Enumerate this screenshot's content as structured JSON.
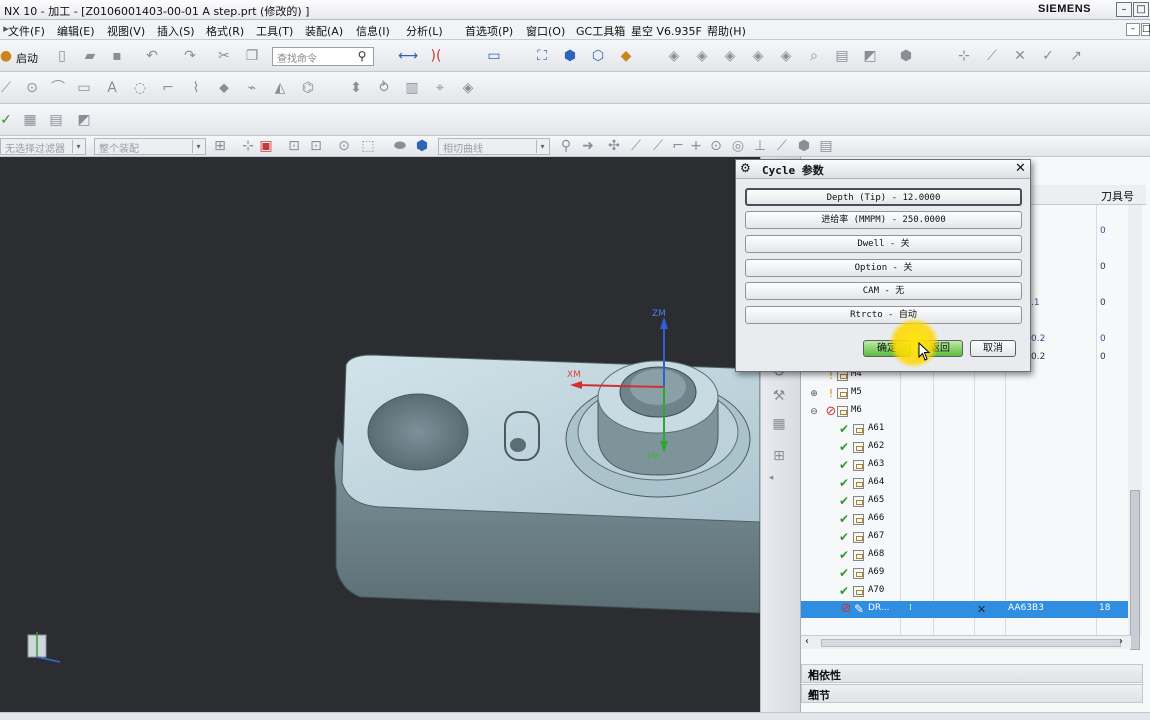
{
  "window": {
    "title": "NX 10 - 加工 - [Z0106001403-00-01 A step.prt  (修改的) ]",
    "brand": "SIEMENS"
  },
  "menu": [
    "文件(F)",
    "编辑(E)",
    "视图(V)",
    "插入(S)",
    "格式(R)",
    "工具(T)",
    "装配(A)",
    "信息(I)",
    "分析(L)",
    "首选项(P)",
    "窗口(O)",
    "GC工具箱",
    "星空 V6.935F",
    "帮助(H)"
  ],
  "toolbar": {
    "start_label": "启动",
    "search_placeholder": "查找命令",
    "filter_combo": "无选择过滤器",
    "assembly_combo": "整个装配",
    "curve_combo": "相切曲线"
  },
  "viewport": {
    "wcs_labels": {
      "zm": "ZM",
      "xm": "XM",
      "ym": "YM"
    }
  },
  "navigator": {
    "header": {
      "tool_number": "刀具号"
    },
    "rows": [
      {
        "label": "",
        "value": "0"
      },
      {
        "label": "",
        "value": "0"
      },
      {
        "label": "",
        "value": "0"
      },
      {
        "label": "",
        "value": "0"
      },
      {
        "label": "",
        "value": "0"
      }
    ],
    "partial_values": [
      ".1",
      "0.2",
      "0.2"
    ],
    "groups": [
      {
        "label": "M4",
        "status": "warn"
      },
      {
        "label": "M5",
        "status": "warn"
      },
      {
        "label": "M6",
        "status": "blocked"
      }
    ],
    "ops": [
      "A61",
      "A62",
      "A63",
      "A64",
      "A65",
      "A66",
      "A67",
      "A68",
      "A69",
      "A70"
    ],
    "selected": {
      "name": "DR...",
      "tool": "AA63B3",
      "tool_number": "18"
    },
    "sections": [
      "相依性",
      "细节"
    ]
  },
  "dialog": {
    "title": "Cycle 参数",
    "params": [
      "Depth (Tip) - 12.0000",
      "进给率 (MMPM) - 250.0000",
      "Dwell - 关",
      "Option - 关",
      "CAM - 无",
      "Rtrcto - 自动"
    ],
    "buttons": {
      "ok": "确定",
      "back": "返回",
      "cancel": "取消"
    }
  }
}
